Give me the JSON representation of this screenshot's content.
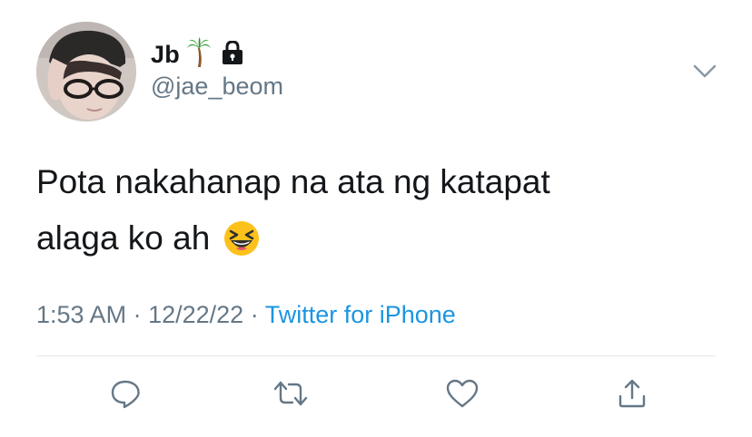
{
  "user": {
    "display_name": "Jb",
    "name_emoji": "palm-tree-icon",
    "protected_icon": "lock-icon",
    "handle": "@jae_beom"
  },
  "tweet": {
    "text_line1": "Pota nakahanap na ata ng katapat",
    "text_line2": "alaga ko ah",
    "emoji": "grinning-squinting-face-emoji"
  },
  "meta": {
    "time": "1:53 AM",
    "separator": "·",
    "date": "12/22/22",
    "source": "Twitter for iPhone"
  },
  "actions": [
    "reply-icon",
    "retweet-icon",
    "like-icon",
    "share-icon"
  ],
  "colors": {
    "text": "#14171a",
    "secondary": "#657786",
    "link": "#1b95e0",
    "divider": "#e1e8ed"
  }
}
